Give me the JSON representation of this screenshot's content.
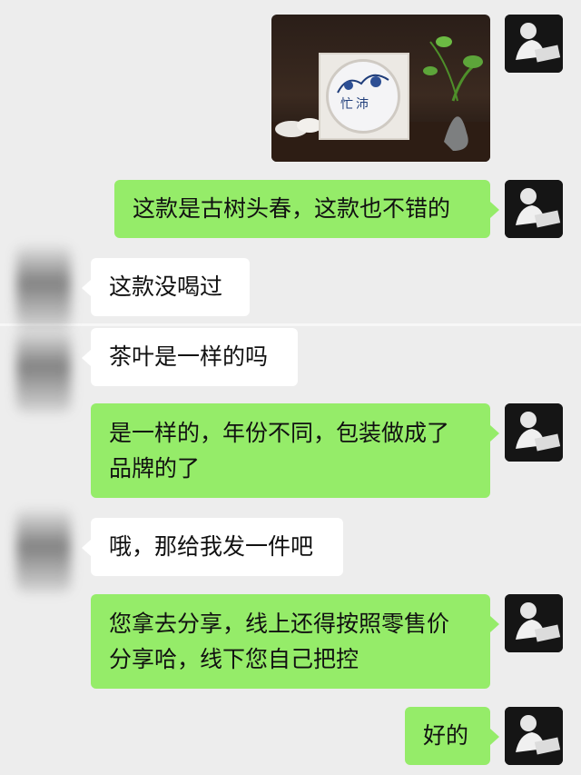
{
  "chat": {
    "messages": [
      {
        "side": "right",
        "type": "image",
        "image_label": "忙沛"
      },
      {
        "side": "right",
        "type": "text",
        "lines": [
          "这款是古树头春，这款也不错的"
        ]
      },
      {
        "side": "left",
        "type": "text",
        "lines": [
          "这款没喝过"
        ]
      },
      {
        "side": "left",
        "type": "text",
        "lines": [
          "茶叶是一样的吗"
        ]
      },
      {
        "side": "right",
        "type": "text",
        "lines": [
          "是一样的，年份不同，包装做成了",
          "品牌的了"
        ]
      },
      {
        "side": "left",
        "type": "text",
        "lines": [
          "哦，那给我发一件吧"
        ]
      },
      {
        "side": "right",
        "type": "text",
        "lines": [
          "您拿去分享，线上还得按照零售价",
          "分享哈，线下您自己把控"
        ]
      },
      {
        "side": "right",
        "type": "text",
        "lines": [
          "好的"
        ]
      }
    ]
  },
  "colors": {
    "background": "#ededed",
    "self_bubble": "#95ec69",
    "other_bubble": "#ffffff",
    "text": "#111111"
  },
  "icons": {
    "self_avatar": "person-reading-avatar",
    "other_avatar": "blurred-avatar"
  }
}
